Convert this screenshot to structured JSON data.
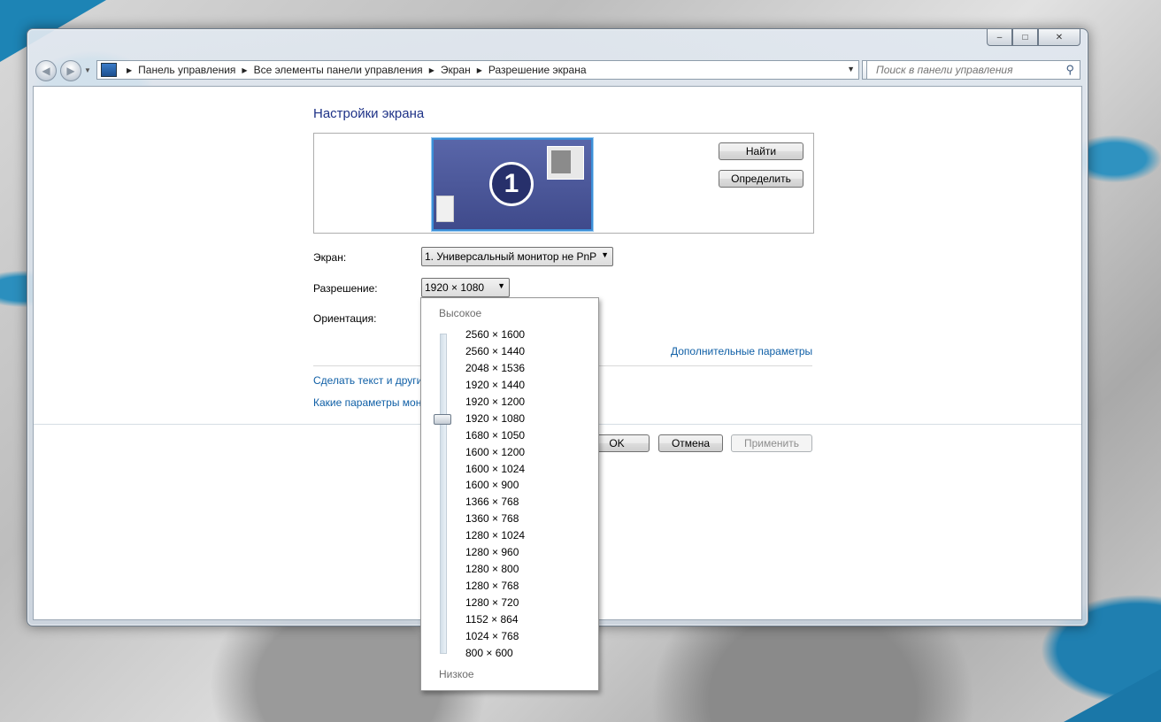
{
  "window": {
    "caption_buttons": {
      "minimize": "–",
      "maximize": "□",
      "close": "✕"
    }
  },
  "address_bar": {
    "breadcrumbs": [
      "Панель управления",
      "Все элементы панели управления",
      "Экран",
      "Разрешение экрана"
    ]
  },
  "search": {
    "placeholder": "Поиск в панели управления"
  },
  "main": {
    "title": "Настройки экрана",
    "monitor_number": "1",
    "find_button": "Найти",
    "identify_button": "Определить",
    "screen_label": "Экран:",
    "screen_value": "1. Универсальный монитор не PnP",
    "resolution_label": "Разрешение:",
    "resolution_value": "1920 × 1080",
    "orientation_label": "Ориентация:",
    "advanced_link": "Дополнительные параметры",
    "text_size_link": "Сделать текст и другие",
    "which_settings_link": "Какие параметры мон",
    "ok_button": "OK",
    "cancel_button": "Отмена",
    "apply_button": "Применить"
  },
  "resolution_dropdown": {
    "high_label": "Высокое",
    "low_label": "Низкое",
    "selected_index": 5,
    "options": [
      "2560 × 1600",
      "2560 × 1440",
      "2048 × 1536",
      "1920 × 1440",
      "1920 × 1200",
      "1920 × 1080",
      "1680 × 1050",
      "1600 × 1200",
      "1600 × 1024",
      "1600 × 900",
      "1366 × 768",
      "1360 × 768",
      "1280 × 1024",
      "1280 × 960",
      "1280 × 800",
      "1280 × 768",
      "1280 × 720",
      "1152 × 864",
      "1024 × 768",
      "800 × 600"
    ]
  },
  "colors": {
    "title": "#1e3287",
    "link": "#0f5fa6",
    "monitor": "#4b569a",
    "accent_wallpaper": "#1d84b5"
  }
}
